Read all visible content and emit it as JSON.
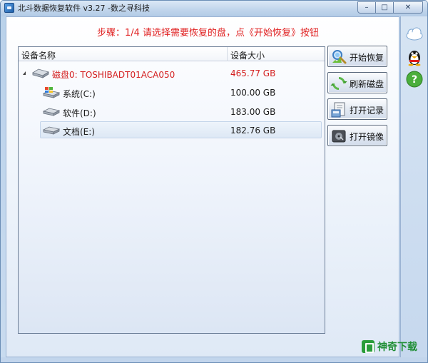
{
  "window": {
    "title": "北斗数据恢复软件 v3.27 -数之寻科技",
    "btn_minimize": "–",
    "btn_restore": "□",
    "btn_close": "✕"
  },
  "step": {
    "text": "步骤：1/4 请选择需要恢复的盘，点《开始恢复》按钮"
  },
  "grid": {
    "col_name": "设备名称",
    "col_size": "设备大小",
    "rows": [
      {
        "name": "磁盘0: TOSHIBADT01ACA050",
        "size": "465.77 GB",
        "type": "disk"
      },
      {
        "name": "系统(C:)",
        "size": "100.00 GB",
        "type": "system"
      },
      {
        "name": "软件(D:)",
        "size": "183.00 GB",
        "type": "partition"
      },
      {
        "name": "文档(E:)",
        "size": "182.76 GB",
        "type": "partition",
        "selected": true
      }
    ]
  },
  "buttons": {
    "start": "开始恢复",
    "refresh": "刷新磁盘",
    "open_record": "打开记录",
    "open_image": "打开镜像"
  },
  "sidebar_icons": [
    "cloud-icon",
    "qq-penguin-icon",
    "help-icon"
  ],
  "watermark": {
    "text": "神奇下载"
  },
  "colors": {
    "accent_red": "#e02020",
    "disk_red": "#d42020",
    "brand_green": "#1f8e35"
  }
}
